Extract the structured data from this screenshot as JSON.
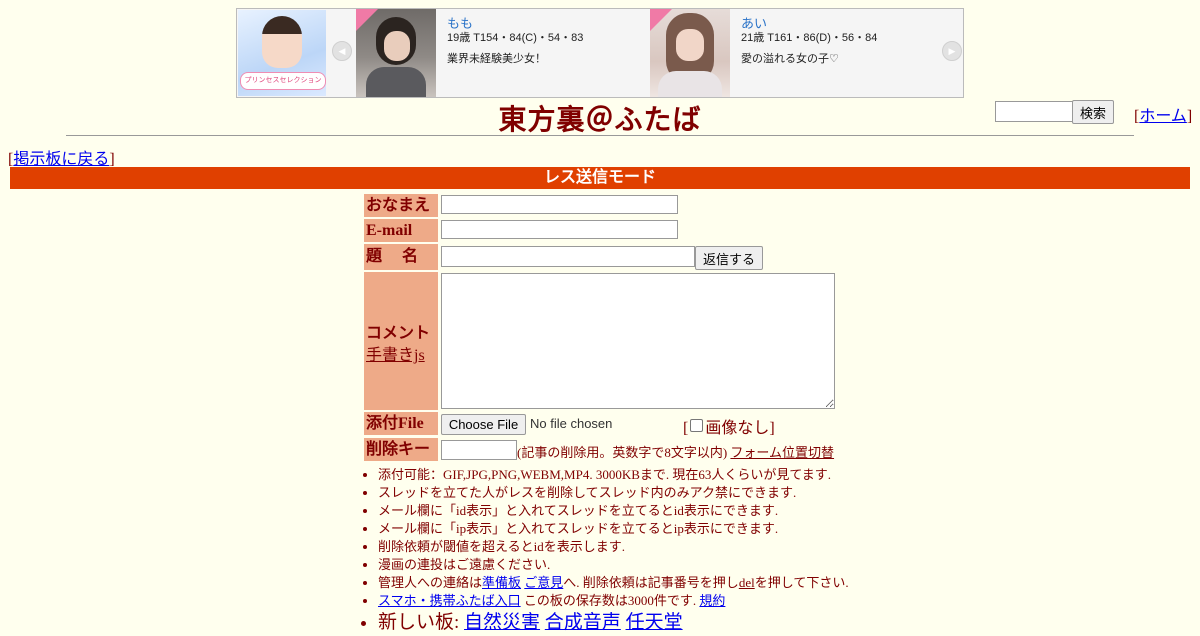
{
  "ad": {
    "logo_text": "プリンセスセレクション",
    "cards": [
      {
        "name": "もも",
        "stats": "19歳 T154・84(C)・54・83",
        "copy": "業界未経験美少女！"
      },
      {
        "name": "あい",
        "stats": "21歳 T161・86(D)・56・84",
        "copy": "愛の溢れる女の子♡"
      }
    ],
    "prev_icon": "◀",
    "next_icon": "▶"
  },
  "header": {
    "title": "東方裏＠ふたば",
    "search_button": "検索",
    "home_bracket_open": "[",
    "home_link": "ホーム",
    "home_bracket_close": "]"
  },
  "nav": {
    "back_bracket_open": "[",
    "back_link": "掲示板に戻る",
    "back_bracket_close": "]"
  },
  "mode_bar": "レス送信モード",
  "form": {
    "name_label": "おなまえ",
    "email_label": "E-mail",
    "subject_label": "題　 名",
    "submit_button": "返信する",
    "comment_label": "コメント",
    "tegaki_link": "手書きjs",
    "file_label": "添付File",
    "choose_file_button": "Choose File",
    "no_file_text": "No file chosen",
    "noimage_open": "[",
    "noimage_label": "画像なし",
    "noimage_close": "]",
    "delkey_label": "削除キー",
    "delkey_note": "(記事の削除用。英数字で8文字以内)",
    "form_toggle_link": "フォーム位置切替"
  },
  "notes": {
    "n1": "添付可能：GIF,JPG,PNG,WEBM,MP4. 3000KBまで. 現在63人くらいが見てます.",
    "n2": "スレッドを立てた人がレスを削除してスレッド内のみアク禁にできます.",
    "n3": "メール欄に「id表示」と入れてスレッドを立てるとid表示にできます.",
    "n4": "メール欄に「ip表示」と入れてスレッドを立てるとip表示にできます.",
    "n5": "削除依頼が閾値を超えるとidを表示します.",
    "n6": "漫画の連投はご遠慮ください.",
    "n7_pre": "管理人への連絡は",
    "n7_link1": "準備板",
    "n7_space": " ",
    "n7_link2": "ご意見",
    "n7_mid": "へ. 削除依頼は記事番号を押し",
    "n7_del": "del",
    "n7_post": "を押して下さい.",
    "n8_link": "スマホ・携帯ふたば入口",
    "n8_mid": " この板の保存数は3000件です. ",
    "n8_link2": "規約",
    "n9_pre": "新しい板: ",
    "n9_link1": "自然災害",
    "n9_link2": "合成音声",
    "n9_link3": "任天堂"
  }
}
